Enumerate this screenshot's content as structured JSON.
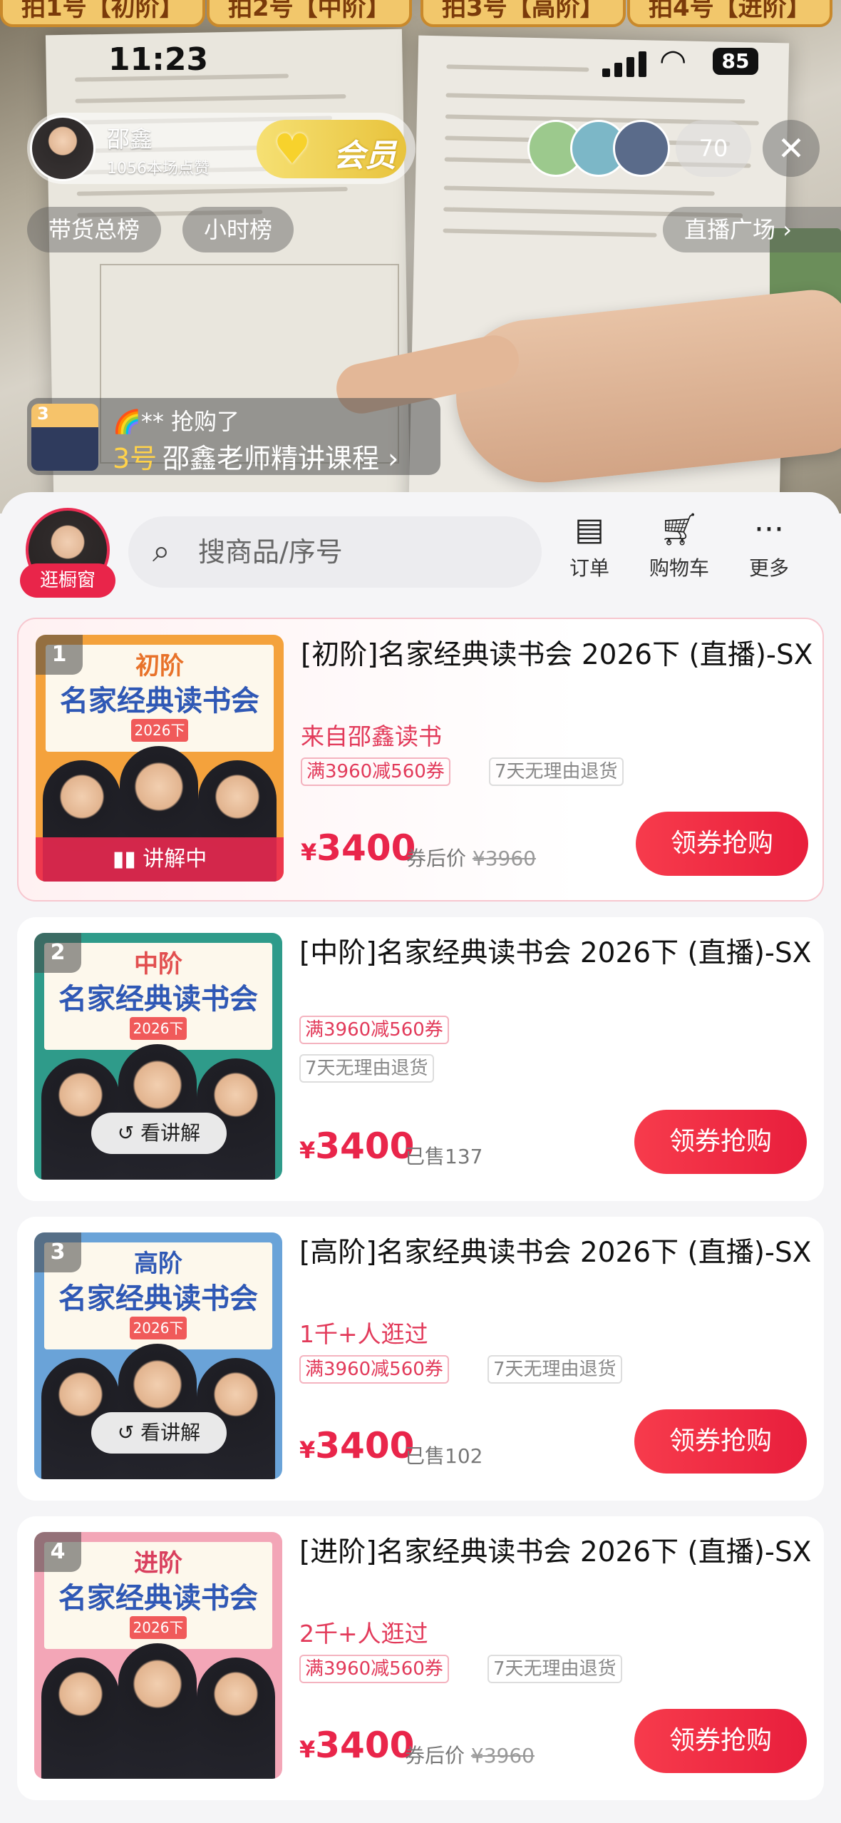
{
  "top_tabs": [
    "拍1号【初阶】",
    "拍2号【中阶】",
    "拍3号【高阶】",
    "拍4号【进阶】"
  ],
  "status": {
    "time": "11:23",
    "battery": "85"
  },
  "host": {
    "name": "邵鑫",
    "likes": "1056本场点赞",
    "fan_label": "会员"
  },
  "viewer_count": "70",
  "close": "✕",
  "rank_tabs": {
    "sales": "带货总榜",
    "hourly": "小时榜",
    "plaza": "直播广场"
  },
  "purchase_toast": {
    "thumb_num": "3",
    "user": "🌈** 抢购了",
    "index": "3号",
    "title": "邵鑫老师精讲课程"
  },
  "shop": {
    "button": "逛橱窗"
  },
  "search": {
    "placeholder": "搜商品/序号"
  },
  "tools": [
    {
      "label": "订单",
      "icon": "clipboard-icon"
    },
    {
      "label": "购物车",
      "icon": "cart-icon"
    },
    {
      "label": "更多",
      "icon": "more-icon"
    }
  ],
  "products": [
    {
      "index": "1",
      "level": "初阶",
      "cover_title": "名家经典读书会",
      "cover_year": "2026下",
      "title": "[初阶]名家经典读书会 2026下 (直播)-SX",
      "meta": "来自邵鑫读书",
      "coupon": "满3960减560券",
      "return_tag": "7天无理由退货",
      "currency": "¥",
      "price": "3400",
      "note": "券后价",
      "original": "¥3960",
      "status": "讲解中",
      "buy": "领券抢购"
    },
    {
      "index": "2",
      "level": "中阶",
      "cover_title": "名家经典读书会",
      "cover_year": "2026下",
      "title": "[中阶]名家经典读书会 2026下 (直播)-SX",
      "coupon": "满3960减560券",
      "return_tag": "7天无理由退货",
      "currency": "¥",
      "price": "3400",
      "note": "已售137",
      "replay": "看讲解",
      "buy": "领券抢购"
    },
    {
      "index": "3",
      "level": "高阶",
      "cover_title": "名家经典读书会",
      "cover_year": "2026下",
      "title": "[高阶]名家经典读书会 2026下 (直播)-SX",
      "meta": "1千+人逛过",
      "coupon": "满3960减560券",
      "return_tag": "7天无理由退货",
      "currency": "¥",
      "price": "3400",
      "note": "已售102",
      "replay": "看讲解",
      "buy": "领券抢购"
    },
    {
      "index": "4",
      "level": "进阶",
      "cover_title": "名家经典读书会",
      "cover_year": "2026下",
      "title": "[进阶]名家经典读书会 2026下 (直播)-SX",
      "meta": "2千+人逛过",
      "coupon": "满3960减560券",
      "return_tag": "7天无理由退货",
      "currency": "¥",
      "price": "3400",
      "note": "券后价",
      "original": "¥3960",
      "buy": "领券抢购"
    }
  ],
  "colors": {
    "accent": "#e9254a",
    "cover_orange": "#f4a23c",
    "cover_teal": "#2f9b8a",
    "cover_blue": "#6aa3d8",
    "cover_pink": "#f3a6b7"
  }
}
